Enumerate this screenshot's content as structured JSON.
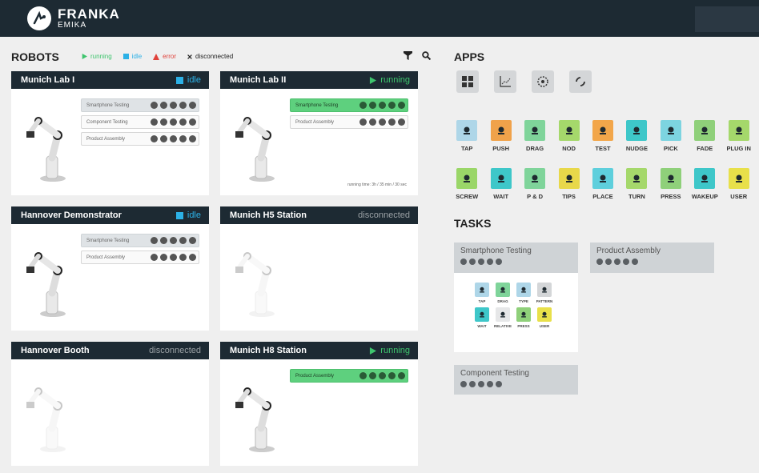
{
  "brand": {
    "name": "FRANKA",
    "sub": "EMIKA"
  },
  "robots_section": {
    "title": "ROBOTS"
  },
  "legend": [
    {
      "label": "running",
      "color": "#3ec46d",
      "icon": "play-icon"
    },
    {
      "label": "idle",
      "color": "#2cb1e6",
      "icon": "square-icon"
    },
    {
      "label": "error",
      "color": "#e0413a",
      "icon": "warning-icon"
    },
    {
      "label": "disconnected",
      "color": "#222222",
      "icon": "x-icon"
    }
  ],
  "robots": [
    {
      "name": "Munich Lab I",
      "status": "idle",
      "tasks": [
        {
          "name": "Smartphone Testing",
          "state": "active"
        },
        {
          "name": "Component Testing",
          "state": "normal"
        },
        {
          "name": "Product Assembly",
          "state": "normal"
        }
      ]
    },
    {
      "name": "Munich Lab II",
      "status": "running",
      "run_time": "running time: 3h / 35 min / 30 sec",
      "tasks": [
        {
          "name": "Smartphone Testing",
          "state": "green"
        },
        {
          "name": "Product Assembly",
          "state": "normal"
        }
      ]
    },
    {
      "name": "Hannover Demonstrator",
      "status": "idle",
      "tasks": [
        {
          "name": "Smartphone Testing",
          "state": "active"
        },
        {
          "name": "Product Assembly",
          "state": "normal"
        }
      ]
    },
    {
      "name": "Munich H5 Station",
      "status": "disconnected",
      "tasks": []
    },
    {
      "name": "Hannover Booth",
      "status": "disconnected",
      "tasks": []
    },
    {
      "name": "Munich H8 Station",
      "status": "running",
      "tasks": [
        {
          "name": "Product Assembly",
          "state": "green"
        }
      ]
    }
  ],
  "apps_section": {
    "title": "APPS"
  },
  "apps_big": [
    "grid-app-icon",
    "chart-app-icon",
    "gear-app-icon",
    "loop-app-icon"
  ],
  "skills_row1": [
    {
      "label": "TAP",
      "color": "#aed6e8"
    },
    {
      "label": "PUSH",
      "color": "#f0a24a"
    },
    {
      "label": "DRAG",
      "color": "#7fd49a"
    },
    {
      "label": "NOD",
      "color": "#a5d86b"
    },
    {
      "label": "TEST",
      "color": "#f2a64a"
    },
    {
      "label": "NUDGE",
      "color": "#3ec7c9"
    },
    {
      "label": "PICK",
      "color": "#7dd4e0"
    },
    {
      "label": "FADE",
      "color": "#8fd07a"
    },
    {
      "label": "PLUG IN",
      "color": "#a5d86b"
    }
  ],
  "skills_row2": [
    {
      "label": "SCREW",
      "color": "#9ad668"
    },
    {
      "label": "WAIT",
      "color": "#3ec7c9"
    },
    {
      "label": "P & D",
      "color": "#7fd49a"
    },
    {
      "label": "TIPS",
      "color": "#e8d84a"
    },
    {
      "label": "PLACE",
      "color": "#5ecfdc"
    },
    {
      "label": "TURN",
      "color": "#a5d86b"
    },
    {
      "label": "PRESS",
      "color": "#8fd07a"
    },
    {
      "label": "WAKEUP",
      "color": "#3ec7c9"
    },
    {
      "label": "USER",
      "color": "#e8e04a"
    }
  ],
  "tasks_section": {
    "title": "TASKS"
  },
  "task_cards": [
    {
      "name": "Smartphone Testing"
    },
    {
      "name": "Product Assembly"
    },
    {
      "name": "Component Testing"
    }
  ],
  "smartphone_skills": [
    {
      "label": "TAP",
      "color": "#aed6e8"
    },
    {
      "label": "DRAG",
      "color": "#7fd49a"
    },
    {
      "label": "TYPE",
      "color": "#aed6e8"
    },
    {
      "label": "PATTERN",
      "color": "#d4d6d8"
    },
    {
      "label": "WAIT",
      "color": "#3ec7c9"
    },
    {
      "label": "RELATIVE",
      "color": "#e6e7e8"
    },
    {
      "label": "PRESS",
      "color": "#8fd07a"
    },
    {
      "label": "USER",
      "color": "#e8e04a"
    }
  ]
}
